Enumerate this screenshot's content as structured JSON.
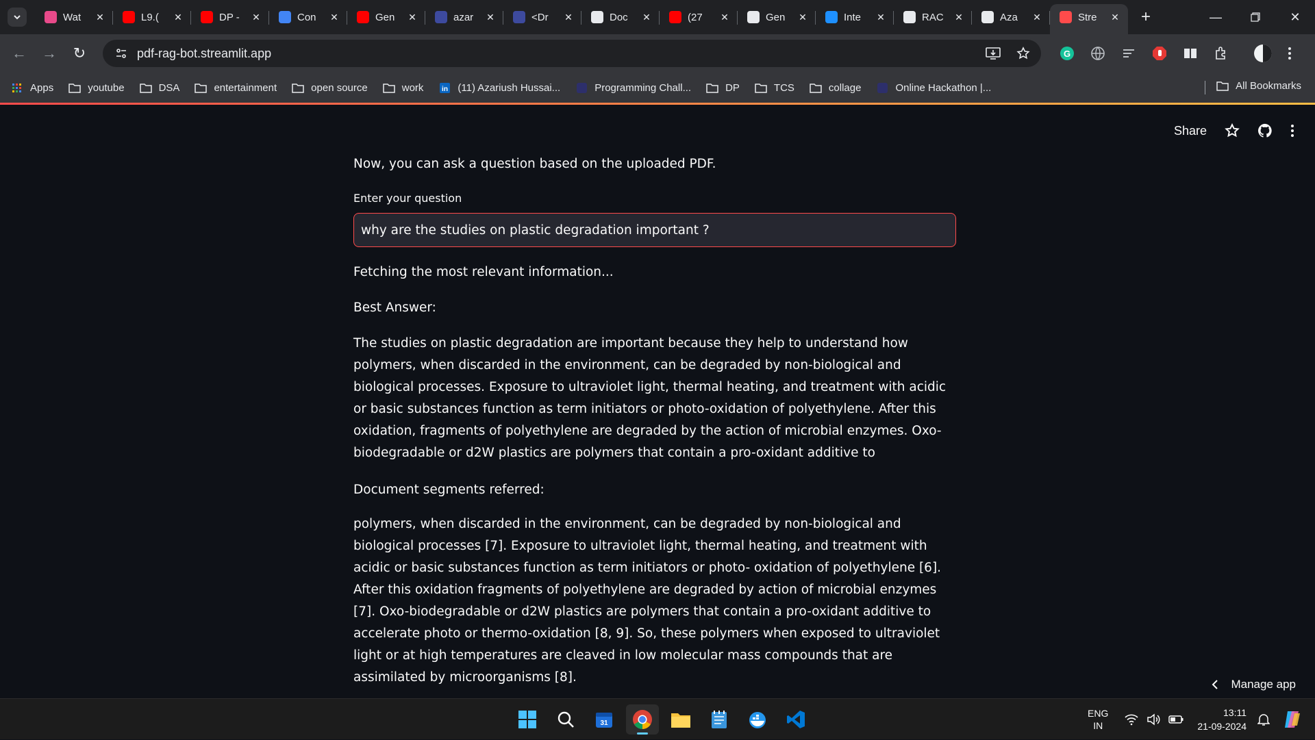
{
  "browser": {
    "tabs": [
      {
        "title": "Wat",
        "icon": "play-icon",
        "color": "#e84a8a"
      },
      {
        "title": "L9.(",
        "icon": "youtube-icon",
        "color": "#ff0000"
      },
      {
        "title": "DP -",
        "icon": "youtube-icon",
        "color": "#ff0000"
      },
      {
        "title": "Con",
        "icon": "chart-icon",
        "color": "#4285f4"
      },
      {
        "title": "Gen",
        "icon": "youtube-icon",
        "color": "#ff0000"
      },
      {
        "title": "azar",
        "icon": "h-icon",
        "color": "#3d4a9e"
      },
      {
        "title": "<Dr",
        "icon": "h-icon",
        "color": "#3d4a9e"
      },
      {
        "title": "Doc",
        "icon": "openai-icon",
        "color": "#e8eaed"
      },
      {
        "title": "(27",
        "icon": "youtube-icon",
        "color": "#ff0000"
      },
      {
        "title": "Gen",
        "icon": "globe-icon",
        "color": "#e8eaed"
      },
      {
        "title": "Inte",
        "icon": "is-icon",
        "color": "#1e90ff"
      },
      {
        "title": "RAC",
        "icon": "globe-icon",
        "color": "#e8eaed"
      },
      {
        "title": "Aza",
        "icon": "github-icon",
        "color": "#e8eaed"
      },
      {
        "title": "Stre",
        "icon": "streamlit-icon",
        "color": "#ff4b4b",
        "active": true
      }
    ],
    "url": "pdf-rag-bot.streamlit.app",
    "bookmarks": [
      {
        "label": "Apps",
        "icon": "apps-grid-icon"
      },
      {
        "label": "youtube",
        "icon": "folder-icon"
      },
      {
        "label": "DSA",
        "icon": "folder-icon"
      },
      {
        "label": "entertainment",
        "icon": "folder-icon"
      },
      {
        "label": "open source",
        "icon": "folder-icon"
      },
      {
        "label": "work",
        "icon": "folder-icon"
      },
      {
        "label": "(11) Azariush Hussai...",
        "icon": "linkedin-icon"
      },
      {
        "label": "Programming Chall...",
        "icon": "site-icon"
      },
      {
        "label": "DP",
        "icon": "folder-icon"
      },
      {
        "label": "TCS",
        "icon": "folder-icon"
      },
      {
        "label": "collage",
        "icon": "folder-icon"
      },
      {
        "label": "Online Hackathon |...",
        "icon": "site-icon"
      }
    ],
    "all_bookmarks": "All Bookmarks"
  },
  "header": {
    "share": "Share"
  },
  "main": {
    "intro": "Now, you can ask a question based on the uploaded PDF.",
    "question_label": "Enter your question",
    "question_value": "why are the studies on plastic degradation important ?",
    "fetching": "Fetching the most relevant information...",
    "best_answer_label": "Best Answer:",
    "answer": "The studies on plastic degradation are important because they help to understand how polymers, when discarded in the environment, can be degraded by non-biological and biological processes. Exposure to ultraviolet light, thermal heating, and treatment with acidic or basic substances function as term initiators or photo-oxidation of polyethylene. After this oxidation, fragments of polyethylene are degraded by the action of microbial enzymes. Oxo-biodegradable or d2W plastics are polymers that contain a pro-oxidant additive to",
    "doc_segments_label": "Document segments referred:",
    "doc_segments": "polymers, when discarded in the environment, can be degraded by non-biological and biological processes [7]. Exposure to ultraviolet light, thermal heating, and treatment with acidic or basic substances function as term initiators or photo- oxidation of polyethylene [6]. After this oxidation fragments of polyethylene are degraded by action of microbial enzymes [7]. Oxo-biodegradable or d2W plastics are polymers that contain a pro-oxidant additive to accelerate photo or thermo-oxidation [8, 9]. So, these polymers when exposed to ultraviolet light or at high temperatures are cleaved in low molecular mass compounds that are assimilated by microorganisms [8]."
  },
  "manage_app": "Manage app",
  "taskbar": {
    "lang_top": "ENG",
    "lang_bottom": "IN",
    "time": "13:11",
    "date": "21-09-2024"
  }
}
